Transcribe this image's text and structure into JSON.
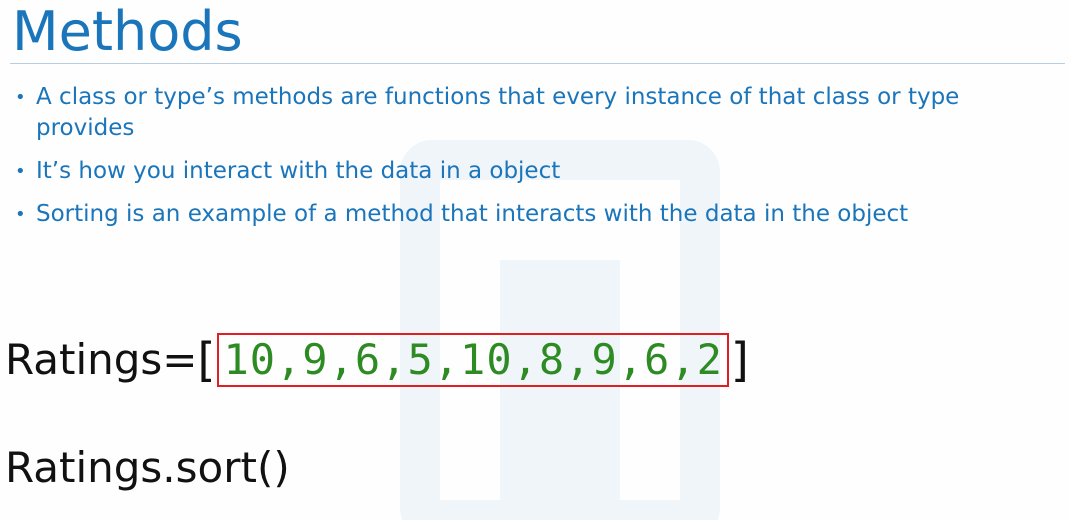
{
  "slide": {
    "title": "Methods",
    "bullets": [
      "A class or type’s methods are functions that every instance of that class or type provides",
      "It’s how you interact with the data in a object",
      "Sorting is an example of a method that interacts with the data in the object"
    ],
    "bullet_glyph": "•"
  },
  "code": {
    "ratings_prefix": "Ratings=",
    "open_bracket": "[",
    "list_values": "10,9,6,5,10,8,9,6,2",
    "close_bracket": "]",
    "sort_call": "Ratings.sort()"
  },
  "colors": {
    "title": "#1a75bb",
    "bullets": "#1a75bb",
    "list_values": "#2e8b24",
    "highlight_box": "#e02020",
    "code_text": "#111111"
  }
}
